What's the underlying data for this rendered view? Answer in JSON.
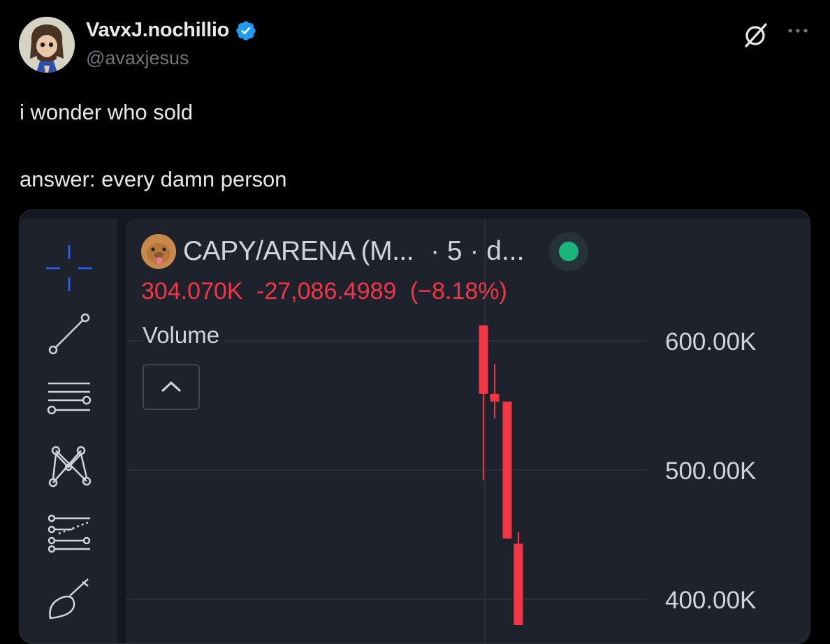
{
  "post": {
    "display_name": "VavxJ.nochillio",
    "handle": "@avaxjesus",
    "text": "i wonder who sold\n\nanswer: every damn person",
    "verified": true
  },
  "chart": {
    "symbol": "CAPY/ARENA (M...",
    "meta": "· 5 · d...",
    "last_price": "304.070K",
    "change": "-27,086.4989",
    "change_pct": "(−8.18%)",
    "volume_label": "Volume",
    "status_color": "#1bb47f",
    "down_color": "#f23645"
  },
  "chart_data": {
    "type": "candlestick",
    "y_ticks": [
      "600.00K",
      "500.00K",
      "400.00K"
    ],
    "ylim": [
      380000,
      600000
    ],
    "candles": [
      {
        "open": 612000,
        "close": 559000,
        "high": 612000,
        "low": 492000
      },
      {
        "open": 559000,
        "close": 553000,
        "high": 582000,
        "low": 540000
      },
      {
        "open": 553000,
        "close": 447000,
        "high": 553000,
        "low": 447000
      },
      {
        "open": 443000,
        "close": 380000,
        "high": 452000,
        "low": 380000
      }
    ]
  },
  "toolbar": {
    "tools": [
      "crosshair-icon",
      "trendline-icon",
      "fib-retracement-icon",
      "pattern-icon",
      "forecast-icon",
      "brush-icon"
    ]
  }
}
